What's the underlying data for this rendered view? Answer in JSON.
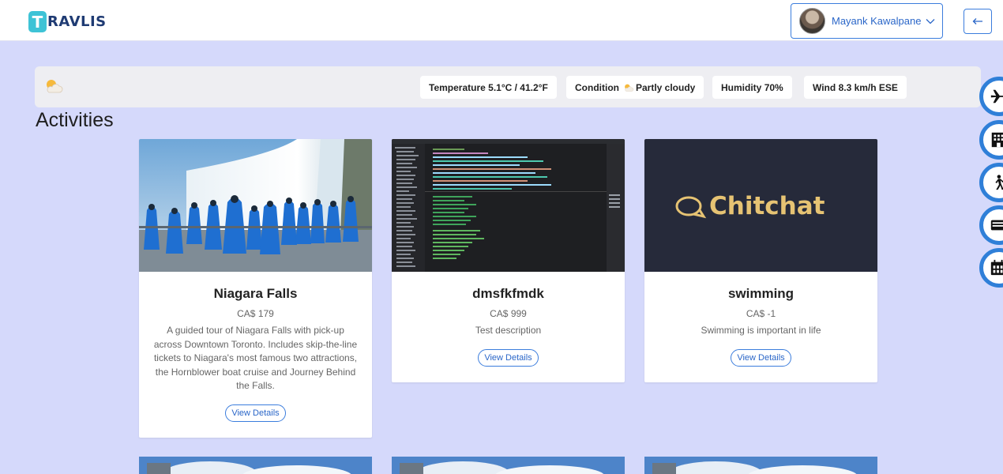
{
  "header": {
    "logo_letter": "T",
    "logo_text": "RAVLIS",
    "user_name": "Mayank Kawalpane",
    "icons": [
      "avatar",
      "chevron-down-icon",
      "back-arrow-icon"
    ]
  },
  "weather": {
    "icon": "partly-cloudy-icon",
    "temperature_label": "Temperature",
    "temperature_value": "5.1°C / 41.2°F",
    "condition_label": "Condition",
    "condition_value": "Partly cloudy",
    "humidity_label": "Humidity",
    "humidity_value": "70%",
    "wind_label": "Wind",
    "wind_value": "8.3 km/h ESE"
  },
  "section_title": "Activities",
  "activities": [
    {
      "title": "Niagara Falls",
      "price": "CA$ 179",
      "description": "A guided tour of Niagara Falls with pick-up across Downtown Toronto. Includes skip-the-line tickets to Niagara's most famous two attractions, the Hornblower boat cruise and Journey Behind the Falls.",
      "button": "View Details",
      "image": "niagara-falls-photo"
    },
    {
      "title": "dmsfkfmdk",
      "price": "CA$ 999",
      "description": "Test description",
      "button": "View Details",
      "image": "code-editor-screenshot"
    },
    {
      "title": "swimming",
      "price": "CA$ -1",
      "description": "Swimming is important in life",
      "button": "View Details",
      "image": "chitchat-logo",
      "image_text": "Chitchat"
    }
  ],
  "side_nav": [
    "plane-icon",
    "hotel-icon",
    "activity-icon",
    "car-icon",
    "calendar-icon"
  ],
  "colors": {
    "page_bg": "#d5d9fb",
    "accent": "#2f7fd8",
    "logo": "#3ec3d6"
  }
}
